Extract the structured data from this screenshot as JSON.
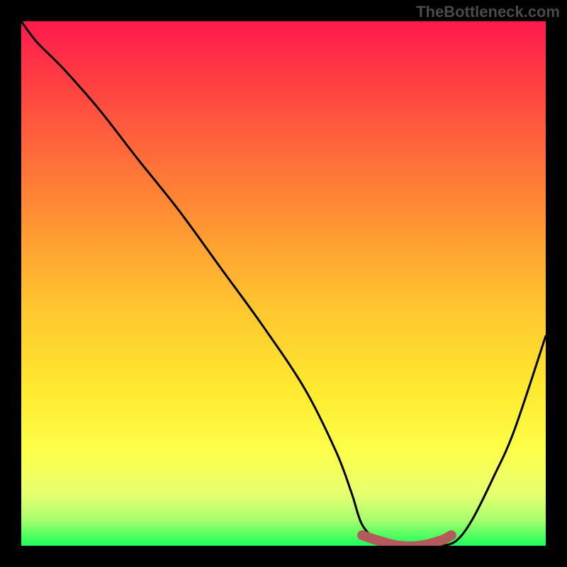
{
  "watermark": "TheBottleneck.com",
  "chart_data": {
    "type": "line",
    "title": "",
    "xlabel": "",
    "ylabel": "",
    "xlim": [
      0,
      100
    ],
    "ylim": [
      0,
      100
    ],
    "grid": false,
    "background_gradient": {
      "top": "#ff1a4d",
      "upper_mid": "#ff9933",
      "mid": "#ffe92f",
      "lower": "#a9ff6f",
      "bottom": "#1cff5a"
    },
    "series": [
      {
        "name": "bottleneck-curve",
        "color": "#000000",
        "x": [
          0,
          3,
          8,
          15,
          22,
          30,
          38,
          46,
          54,
          60,
          63,
          65,
          68,
          72,
          76,
          80,
          83,
          86,
          90,
          94,
          100
        ],
        "y": [
          100,
          96,
          91,
          83,
          74,
          64,
          53,
          42,
          30,
          18,
          10,
          4,
          1,
          0,
          0,
          0,
          1,
          5,
          13,
          22,
          40
        ]
      },
      {
        "name": "minimum-marker",
        "color": "#b55a5a",
        "x": [
          65,
          68,
          72,
          76,
          80,
          82
        ],
        "y": [
          2,
          1,
          0,
          0,
          1,
          2
        ]
      }
    ],
    "annotations": []
  }
}
